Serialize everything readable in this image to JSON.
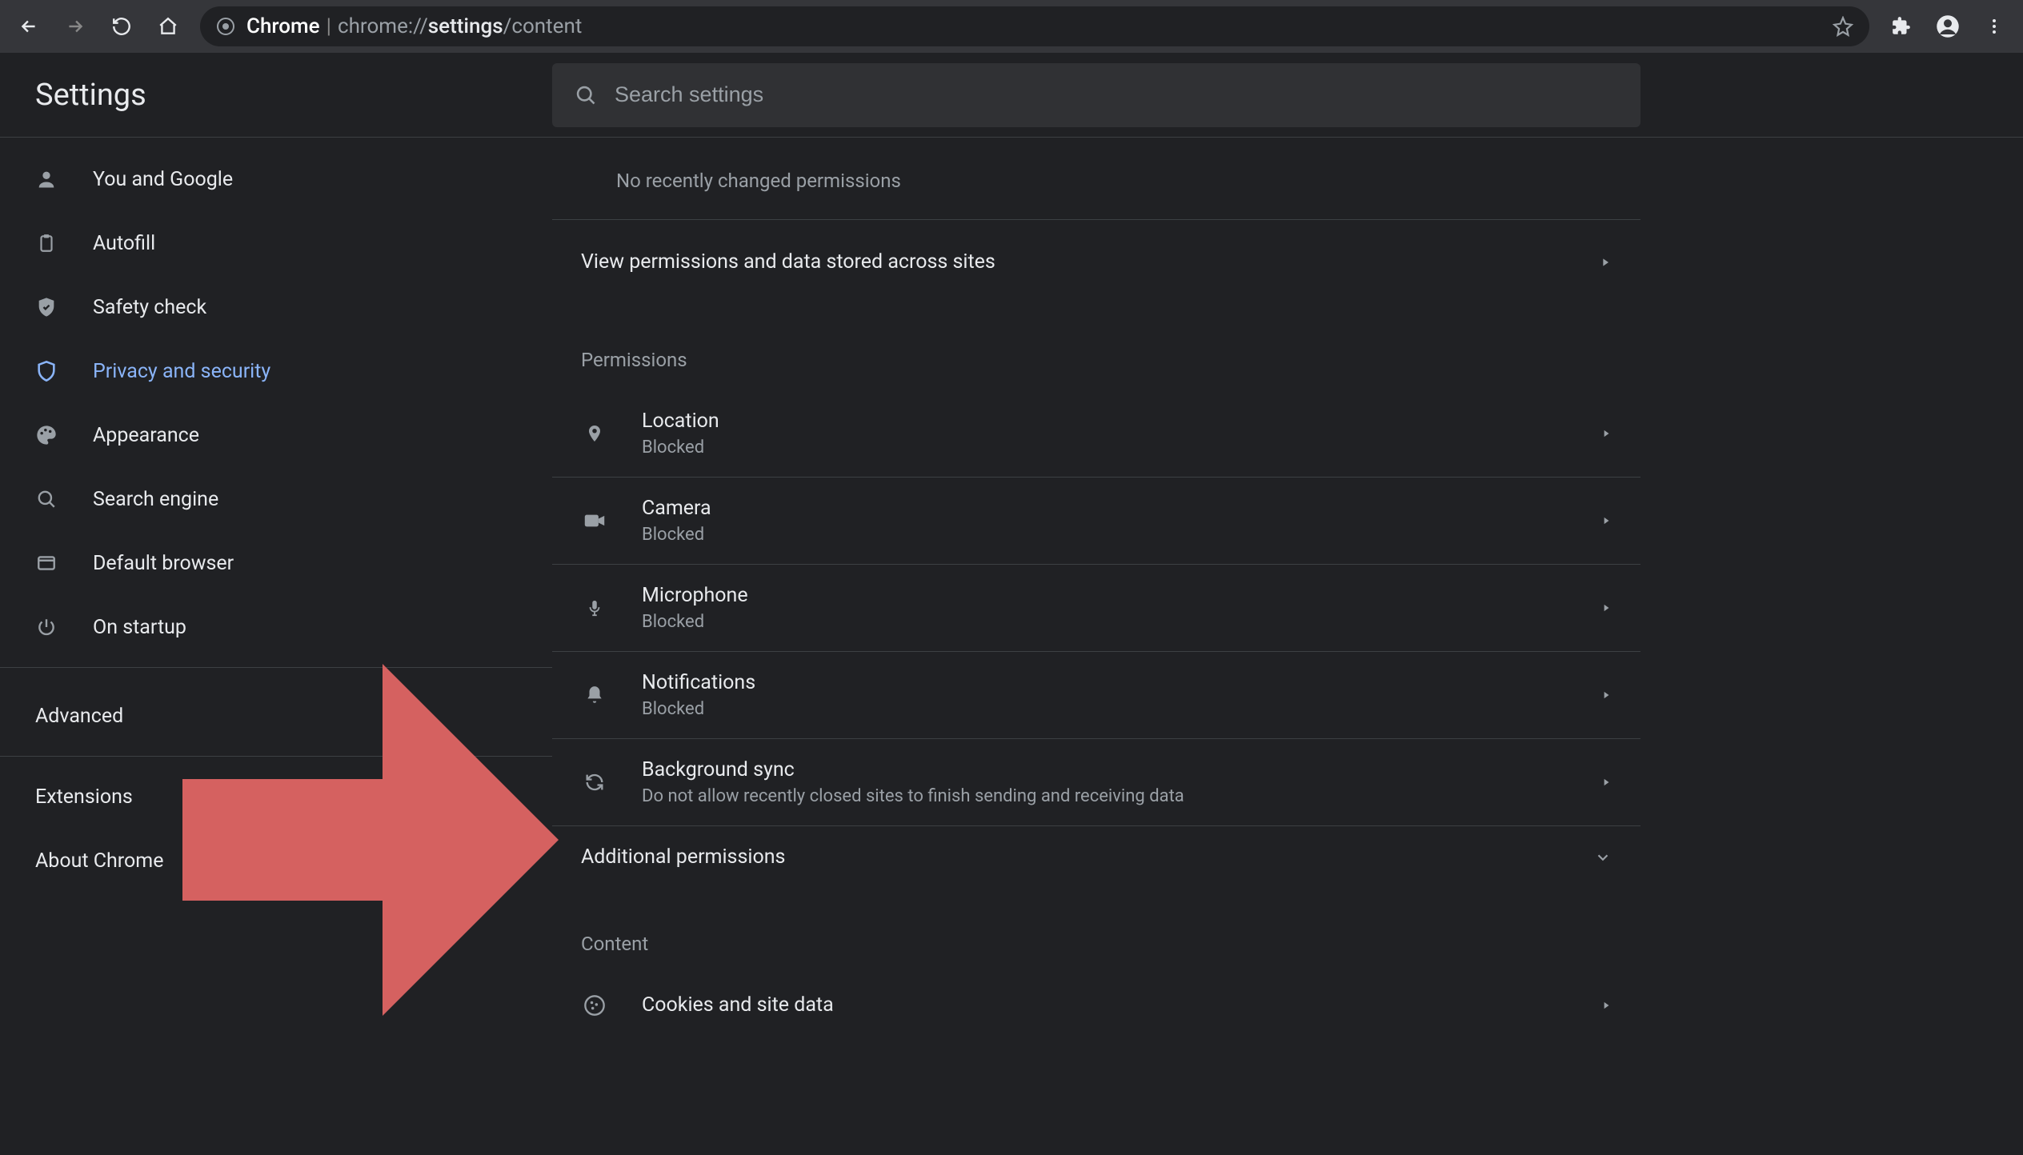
{
  "omnibox": {
    "chrome_label": "Chrome",
    "url_prefix": "chrome://",
    "url_bold": "settings",
    "url_suffix": "/content"
  },
  "header": {
    "title": "Settings",
    "search_placeholder": "Search settings"
  },
  "sidebar": {
    "items": [
      {
        "label": "You and Google"
      },
      {
        "label": "Autofill"
      },
      {
        "label": "Safety check"
      },
      {
        "label": "Privacy and security"
      },
      {
        "label": "Appearance"
      },
      {
        "label": "Search engine"
      },
      {
        "label": "Default browser"
      },
      {
        "label": "On startup"
      }
    ],
    "advanced": "Advanced",
    "extensions": "Extensions",
    "about": "About Chrome"
  },
  "main": {
    "recent_note": "No recently changed permissions",
    "view_permissions": "View permissions and data stored across sites",
    "permissions_label": "Permissions",
    "permissions": [
      {
        "title": "Location",
        "sub": "Blocked"
      },
      {
        "title": "Camera",
        "sub": "Blocked"
      },
      {
        "title": "Microphone",
        "sub": "Blocked"
      },
      {
        "title": "Notifications",
        "sub": "Blocked"
      },
      {
        "title": "Background sync",
        "sub": "Do not allow recently closed sites to finish sending and receiving data"
      }
    ],
    "additional": "Additional permissions",
    "content_label": "Content",
    "content_items": [
      {
        "title": "Cookies and site data"
      }
    ]
  }
}
